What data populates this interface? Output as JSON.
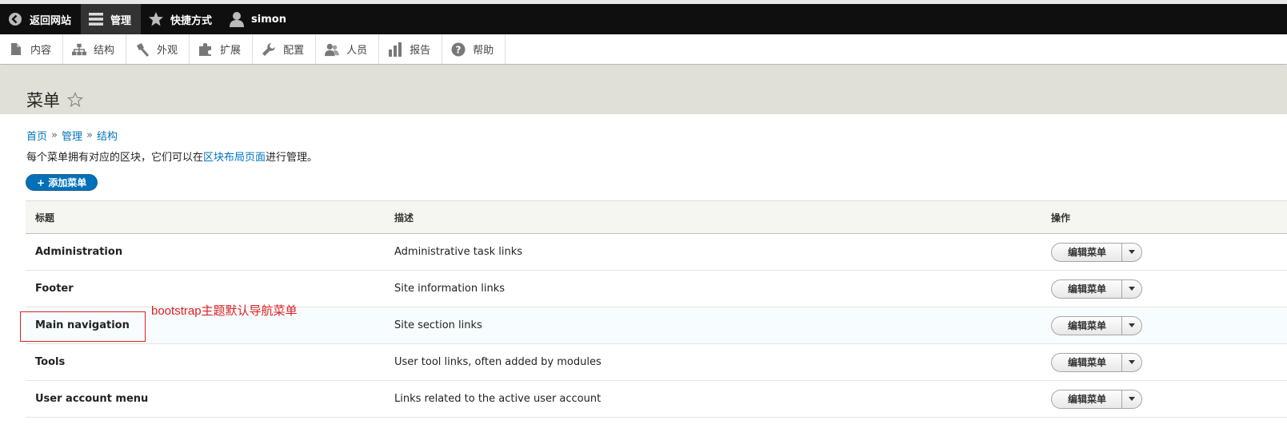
{
  "toolbar": {
    "back_label": "返回网站",
    "manage_label": "管理",
    "shortcuts_label": "快捷方式",
    "user_label": "simon"
  },
  "tray": {
    "items": [
      {
        "label": "内容",
        "icon": "file-icon"
      },
      {
        "label": "结构",
        "icon": "sitemap-icon"
      },
      {
        "label": "外观",
        "icon": "brush-icon"
      },
      {
        "label": "扩展",
        "icon": "puzzle-icon"
      },
      {
        "label": "配置",
        "icon": "wrench-icon"
      },
      {
        "label": "人员",
        "icon": "people-icon"
      },
      {
        "label": "报告",
        "icon": "bar-chart-icon"
      },
      {
        "label": "帮助",
        "icon": "help-icon"
      }
    ]
  },
  "page": {
    "title": "菜单",
    "breadcrumb": [
      {
        "label": "首页"
      },
      {
        "label": "管理"
      },
      {
        "label": "结构"
      }
    ],
    "breadcrumb_sep": "»",
    "help_prefix": "每个菜单拥有对应的区块，它们可以在",
    "help_link": "区块布局页面",
    "help_suffix": "进行管理。",
    "add_button": "+ 添加菜单"
  },
  "table": {
    "headers": [
      "标题",
      "描述",
      "操作"
    ],
    "rows": [
      {
        "title": "Administration",
        "description": "Administrative task links",
        "action": "编辑菜单"
      },
      {
        "title": "Footer",
        "description": "Site information links",
        "action": "编辑菜单"
      },
      {
        "title": "Main navigation",
        "description": "Site section links",
        "action": "编辑菜单"
      },
      {
        "title": "Tools",
        "description": "User tool links, often added by modules",
        "action": "编辑菜单"
      },
      {
        "title": "User account menu",
        "description": "Links related to the active user account",
        "action": "编辑菜单"
      }
    ]
  },
  "annotation": {
    "text": "bootstrap主题默认导航菜单",
    "color": "#e02020"
  },
  "colors": {
    "toolbar_bg": "#0f0f0f",
    "link": "#0074bd",
    "primary_button": "#0071b8",
    "header_region": "#e0e0d8"
  }
}
